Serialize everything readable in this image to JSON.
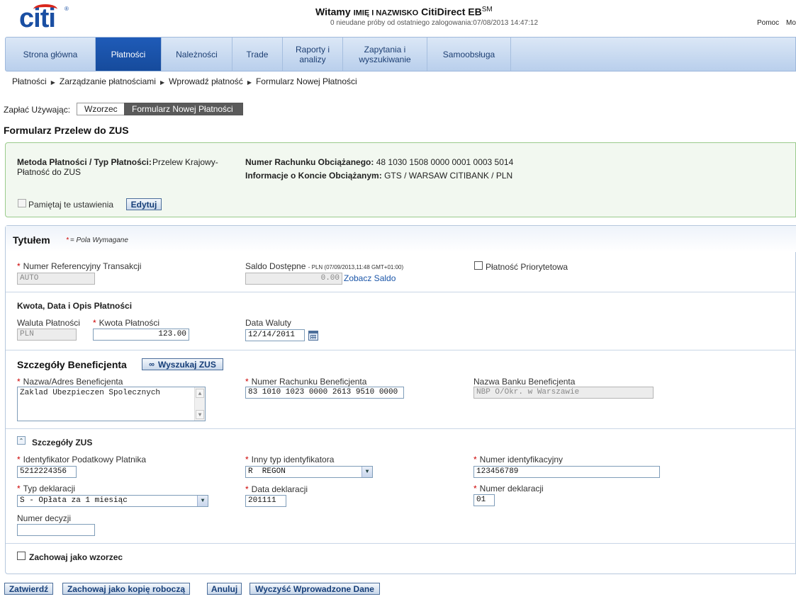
{
  "header": {
    "logo": "citi",
    "welcome": "Witamy",
    "user_name": "IMIĘ I NAZWISKO",
    "product": "CitiDirect EB",
    "product_sup": "SM",
    "login_info": "0 nieudane próby od ostatniego zalogowania:07/08/2013 14:47:12",
    "help": "Pomoc",
    "more": "Mo"
  },
  "nav": [
    {
      "label": "Strona główna",
      "active": false
    },
    {
      "label": "Płatności",
      "active": true
    },
    {
      "label": "Należności",
      "active": false
    },
    {
      "label": "Trade",
      "active": false
    },
    {
      "label": "Raporty i analizy",
      "active": false
    },
    {
      "label": "Zapytania i wyszukiwanie",
      "active": false
    },
    {
      "label": "Samoobsługa",
      "active": false
    }
  ],
  "breadcrumb": [
    "Płatności",
    "Zarządzanie płatnościami",
    "Wprowadź płatność",
    "Formularz Nowej Płatności"
  ],
  "pay_using": {
    "label": "Zapłać Używając:",
    "options": [
      "Wzorzec",
      "Formularz Nowej Płatności"
    ],
    "selected": "Formularz Nowej Płatności"
  },
  "form_title": "Formularz Przelew do ZUS",
  "summary": {
    "method_label": "Metoda Płatności / Typ Płatności:",
    "method_value_1": "Przelew Krajowy-",
    "method_value_2": "Płatność do ZUS",
    "debit_account_label": "Numer Rachunku Obciążanego:",
    "debit_account_value": "48 1030 1508 0000 0001 0003 5014",
    "account_info_label": "Informacje o Koncie Obciążanym:",
    "account_info_value": "GTS / WARSAW CITIBANK / PLN",
    "remember_label": "Pamiętaj te ustawienia",
    "edit_button": "Edytuj"
  },
  "title_section": {
    "title": "Tytułem",
    "required_note": "= Pola Wymagane",
    "required_star": "*",
    "ref_label": "Numer Referencyjny Transakcji",
    "ref_value": "AUTO",
    "balance_label": "Saldo Dostępne",
    "balance_meta": "- PLN (07/09/2013,11:48 GMT+01:00)",
    "balance_value": "0.00",
    "balance_link": "Zobacz Saldo",
    "priority_label": "Płatność Priorytetowa"
  },
  "amount_section": {
    "title": "Kwota, Data i Opis Płatności",
    "currency_label": "Waluta Płatności",
    "currency_value": "PLN",
    "amount_label": "Kwota Płatności",
    "amount_value": "123.00",
    "value_date_label": "Data Waluty",
    "value_date_value": "12/14/2011"
  },
  "beneficiary": {
    "title": "Szczegóły Beneficjenta",
    "search_button": "Wyszukaj ZUS",
    "name_label": "Nazwa/Adres Beneficjenta",
    "name_value": "Zaklad Ubezpieczen Spolecznych",
    "account_label": "Numer Rachunku Beneficjenta",
    "account_value": "83 1010 1023 0000 2613 9510 0000",
    "bank_label": "Nazwa Banku Beneficjenta",
    "bank_value": "NBP O/Okr. w Warszawie"
  },
  "zus": {
    "title": "Szczegóły ZUS",
    "nip_label": "Identyfikator Podatkowy Platnika",
    "nip_value": "5212224356",
    "id_type_label": "Inny typ identyfikatora",
    "id_type_value": "R  REGON",
    "id_number_label": "Numer identyfikacyjny",
    "id_number_value": "123456789",
    "decl_type_label": "Typ deklaracji",
    "decl_type_value": "S - Opłata za 1 miesiąc",
    "decl_date_label": "Data deklaracji",
    "decl_date_value": "201111",
    "decl_number_label": "Numer deklaracji",
    "decl_number_value": "01",
    "decision_label": "Numer decyzji",
    "decision_value": ""
  },
  "save_template_label": "Zachowaj jako wzorzec",
  "buttons": {
    "confirm": "Zatwierdź",
    "save_draft": "Zachowaj jako kopię roboczą",
    "cancel": "Anuluj",
    "clear": "Wyczyść Wprowadzone Dane"
  }
}
